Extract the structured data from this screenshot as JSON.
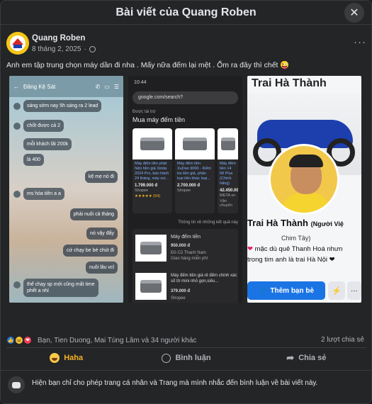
{
  "modal": {
    "title": "Bài viết của Quang Roben",
    "close_icon": "close-icon"
  },
  "post": {
    "author": "Quang Roben",
    "date": "8 tháng 2, 2025",
    "separator": "·",
    "more": "···",
    "text": "Anh em tập trung chọn máy dần đi nha . Mấy nữa đếm lại mệt . Ổm ra đây thì chết 😜"
  },
  "media1": {
    "chat_title": "Đăng Kệ Sát",
    "messages": [
      {
        "text": "sáng sớm nay 5h sáng ra 2 lead"
      },
      {
        "text": "chốt được cả 2"
      },
      {
        "text": "mỗi khách lãi 200k"
      },
      {
        "text": "là 400"
      },
      {
        "text": "kệ mẹ nó đi"
      },
      {
        "text": "ms hóa tiền a a"
      },
      {
        "text": "phải nuôi cả tháng"
      },
      {
        "text": "nó vậy đấy"
      },
      {
        "text": "cứ chạy be bé chút đi"
      },
      {
        "text": "nuôi lâu vcl"
      },
      {
        "text": "thế chạy sp mới cũng mất time\nphết a nhỉ"
      }
    ]
  },
  "media2": {
    "time": "10:44",
    "url": "google.com/search?",
    "sponsored": "Được tài trợ",
    "heading": "Mua máy đếm tiền",
    "cards": [
      {
        "title": "Máy đếm tiền phát hiện tiền giả Xinda 2024 Pro, báo hành 24 tháng, máy soi...",
        "price": "1.799.000 đ",
        "shop": "Shopee",
        "rating": "★★★★★ (64)"
      },
      {
        "title": "Máy đếm tiền XuDan 9000 - Kiểm tra tiền giả, phân loại tiền khác loại...",
        "price": "2.700.000 đ",
        "shop": "Shopee"
      },
      {
        "title": "Máy đếm tiền 14 68 Plus (Chính hãng)",
        "price": "42.450.000",
        "shop": "META.vn",
        "ship": "Vận chuyển"
      }
    ],
    "list_heading": "Thông tin về những kết quả này",
    "rows": [
      {
        "title": "Máy đếm tiền",
        "price": "950.000 đ",
        "shop": "Đồ Cũ Thanh Nam",
        "ship": "Giao hàng miễn phí"
      },
      {
        "title": "Máy đếm tiền giá rẻ đếm chính xác số tờ mini nhỏ gọn,siêu...",
        "price": "379.000 đ",
        "shop": "Shopee"
      }
    ]
  },
  "media3": {
    "name_top": "Trai Hà Thành",
    "name": "Trai Hà Thành",
    "name_suffix": "(Người Việ",
    "nickname": "Chim Tây)",
    "bio1": "mặc dù quê Thanh Hoá nhưn",
    "bio2": "trong tim anh là trai Hà Nội ❤",
    "add_friend": "Thêm bạn bè"
  },
  "engagement": {
    "reactions_text": "Bạn, Tien Duong, Mai Tùng Lâm và 34 người khác",
    "shares": "2 lượt chia sẻ",
    "actions": {
      "haha": "Haha",
      "comment": "Bình luận",
      "share": "Chia sẻ"
    }
  },
  "notice": {
    "text": "Hiện bạn chỉ cho phép trang cá nhân và Trang mà mình nhắc đến bình luận về bài viết này."
  },
  "colors": {
    "bg": "#242526",
    "text": "#e4e6eb",
    "muted": "#b0b3b8",
    "haha": "#f7b125",
    "like": "#1b74e4"
  }
}
